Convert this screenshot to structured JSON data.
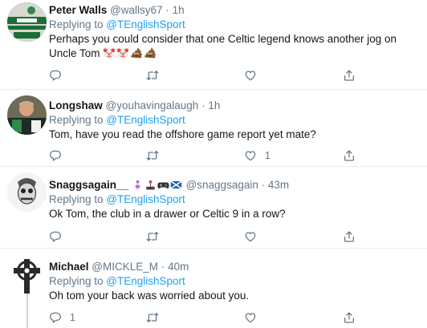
{
  "tweets": [
    {
      "name": "Peter Walls",
      "handle": "@wallsy67",
      "dot": "·",
      "time": "1h",
      "replying_prefix": "Replying to ",
      "mention": "@TEnglishSport",
      "text": "Perhaps you could consider that one Celtic legend knows another jog on Uncle Tom",
      "emoji": [
        "clown-face",
        "clown-face",
        "pile-of-poo",
        "pile-of-poo"
      ],
      "reply_count": "",
      "retweet_count": "",
      "like_count": ""
    },
    {
      "name": "Longshaw",
      "handle": "@youhavingalaugh",
      "dot": "·",
      "time": "1h",
      "replying_prefix": "Replying to ",
      "mention": "@TEnglishSport",
      "text": "Tom, have you read the offshore game report yet mate?",
      "reply_count": "",
      "retweet_count": "",
      "like_count": "1"
    },
    {
      "name": "Snaggsagain__",
      "name_emoji": [
        "genie",
        "joystick",
        "game-controller",
        "scotland-flag"
      ],
      "handle": "@snaggsagain",
      "dot": "·",
      "time": "43m",
      "replying_prefix": "Replying to ",
      "mention": "@TEnglishSport",
      "text": "Ok Tom, the club in a drawer or Celtic 9 in a row?",
      "reply_count": "",
      "retweet_count": "",
      "like_count": ""
    },
    {
      "name": "Michael",
      "handle": "@MICKLE_M",
      "dot": "·",
      "time": "40m",
      "replying_prefix": "Replying to ",
      "mention": "@TEnglishSport",
      "text": "Oh tom your back was worried about you.",
      "reply_count": "1",
      "retweet_count": "",
      "like_count": ""
    }
  ],
  "colors": {
    "link": "#1da1f2",
    "secondary_text": "#657786",
    "divider": "#e6ecf0"
  },
  "icons": {
    "reply": "speech-bubble-icon",
    "retweet": "retweet-arrows-icon",
    "like": "heart-icon",
    "share": "share-upload-icon"
  }
}
